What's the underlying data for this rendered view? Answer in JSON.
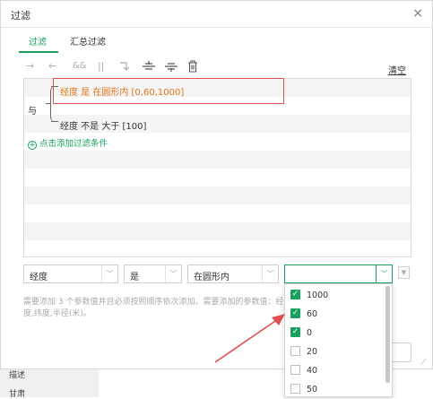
{
  "background": {
    "row1": "描述",
    "row2": "甘肃"
  },
  "dialog": {
    "title": "过滤",
    "close_glyph": "×"
  },
  "tabs": [
    {
      "label": "过滤",
      "active": true
    },
    {
      "label": "汇总过滤",
      "active": false
    }
  ],
  "toolbar": {
    "icons": [
      "indent-right-icon",
      "indent-left-icon",
      "and-icon",
      "or-icon",
      "convert-icon",
      "insert-above-icon",
      "insert-below-icon",
      "delete-icon"
    ],
    "clear_label": "清空"
  },
  "conditions": {
    "condition1": "经度 是 在圆形内 [0,60,1000]",
    "logic": "与",
    "condition2": "经度 不是 大于 [100]",
    "add_label": "点击添加过滤条件"
  },
  "editor": {
    "field": "经度",
    "operator": "是",
    "function": "在圆形内",
    "value": ""
  },
  "hint": "需要添加 3 个参数值并且必须按照顺序依次添加。需要添加的参数值：经度,纬度,半径(米)。",
  "dropdown": {
    "options": [
      {
        "label": "1000",
        "checked": true
      },
      {
        "label": "60",
        "checked": true
      },
      {
        "label": "0",
        "checked": true
      },
      {
        "label": "20",
        "checked": false
      },
      {
        "label": "40",
        "checked": false
      },
      {
        "label": "50",
        "checked": false
      }
    ]
  },
  "colors": {
    "accent": "#19a05f",
    "highlight": "#e05050",
    "condition": "#e0761b"
  }
}
